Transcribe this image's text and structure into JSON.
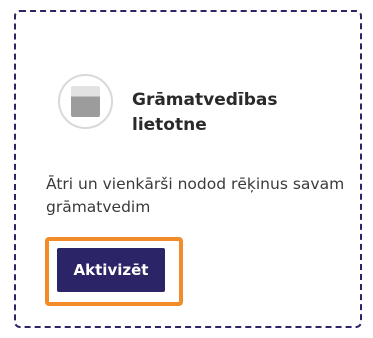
{
  "card": {
    "logo_icon": "app-logo-icon",
    "title": "Grāmatvedības lietotne",
    "description": "Ātri un vienkārši nodod rēķinus savam grāmatvedim",
    "activate_label": "Aktivizēt"
  },
  "colors": {
    "accent": "#2b2466",
    "focus": "#f28c28",
    "border": "#2b2466"
  }
}
